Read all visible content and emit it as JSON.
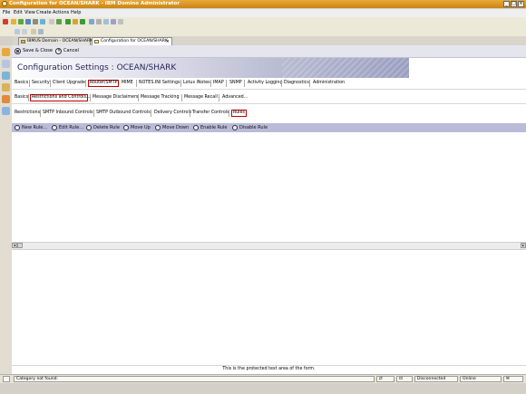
{
  "window": {
    "title": "Configuration for OCEAN/SHARK - IBM Domino Administrator"
  },
  "menubar": [
    "File",
    "Edit",
    "View",
    "Create",
    "Actions",
    "Help"
  ],
  "window_tabs": [
    {
      "label": "IBMUS Domain - OCEAN/SHARK"
    },
    {
      "label": "Configuration for OCEAN/SHARK"
    }
  ],
  "actions": {
    "save_close": "Save & Close",
    "cancel": "Cancel"
  },
  "banner": {
    "title": "Configuration Settings : OCEAN/SHARK"
  },
  "main_tabs": [
    "Basics",
    "Security",
    "Client Upgrade",
    "Router/SMTP",
    "MIME",
    "NOTES.INI Settings",
    "Lotus iNotes",
    "IMAP",
    "SNMP",
    "Activity Logging",
    "Diagnostics",
    "Administration"
  ],
  "main_tab_selected": "Router/SMTP",
  "sub_tabs": [
    "Basics",
    "Restrictions and Controls...",
    "Message Disclaimers",
    "Message Tracking",
    "Message Recall",
    "Advanced..."
  ],
  "sub_tab_selected": "Restrictions and Controls...",
  "subsub_tabs": [
    "Restrictions",
    "SMTP Inbound Controls",
    "SMTP Outbound Controls",
    "Delivery Controls",
    "Transfer Controls",
    "Rules"
  ],
  "subsub_tab_selected": "Rules",
  "rule_actions": [
    "New Rule...",
    "Edit Rule...",
    "Delete Rule",
    "Move Up",
    "Move Down",
    "Enable Rule",
    "Disable Rule"
  ],
  "protected_text": "This is the protected text area of the form.",
  "status": {
    "message": "Category not found.",
    "connection": "Disconnected",
    "location": "Online"
  },
  "colors": {
    "title_bar": "#d6961f",
    "rule_bar": "#b9bbd9",
    "selection_outline": "#c00000"
  }
}
